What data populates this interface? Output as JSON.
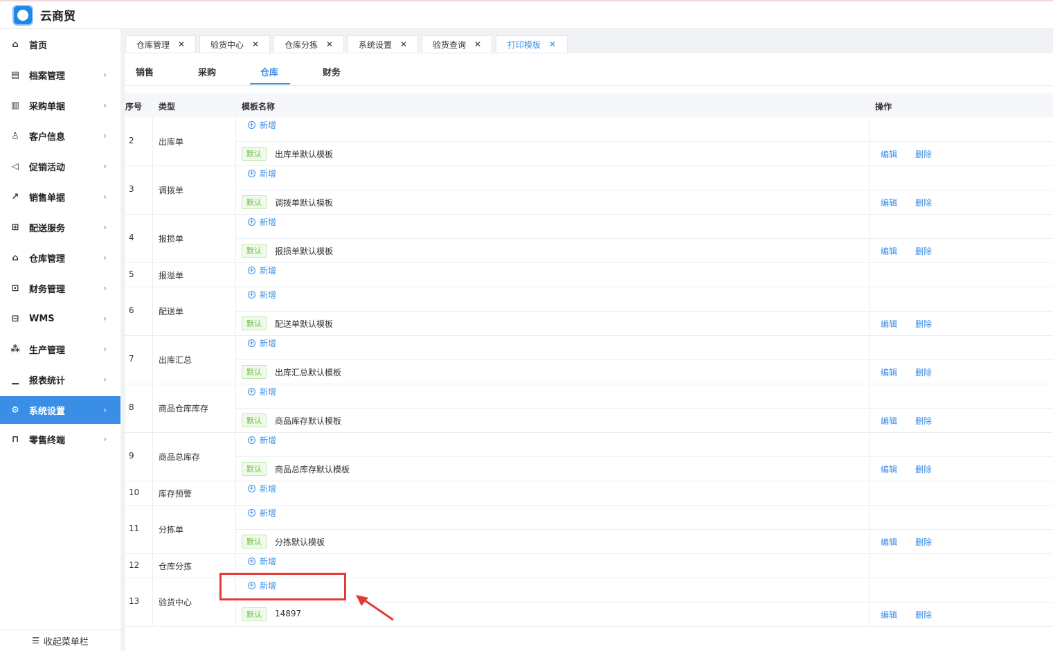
{
  "app": {
    "title": "云商贸"
  },
  "sidebar": {
    "items": [
      {
        "label": "首页",
        "icon": "home-icon",
        "glyph": "⌂",
        "chevron": false
      },
      {
        "label": "档案管理",
        "icon": "archive-icon",
        "glyph": "▤",
        "chevron": true
      },
      {
        "label": "采购单据",
        "icon": "document-icon",
        "glyph": "▥",
        "chevron": true
      },
      {
        "label": "客户信息",
        "icon": "user-icon",
        "glyph": "♙",
        "chevron": true
      },
      {
        "label": "促销活动",
        "icon": "megaphone-icon",
        "glyph": "◁",
        "chevron": true
      },
      {
        "label": "销售单据",
        "icon": "trend-chart-icon",
        "glyph": "↗",
        "chevron": true
      },
      {
        "label": "配送服务",
        "icon": "cart-icon",
        "glyph": "⊞",
        "chevron": true
      },
      {
        "label": "仓库管理",
        "icon": "warehouse-icon",
        "glyph": "⌂",
        "chevron": true
      },
      {
        "label": "财务管理",
        "icon": "finance-icon",
        "glyph": "⊡",
        "chevron": true
      },
      {
        "label": "WMS",
        "icon": "truck-icon",
        "glyph": "⊟",
        "chevron": true
      },
      {
        "label": "生产管理",
        "icon": "network-icon",
        "glyph": "⁂",
        "chevron": true
      },
      {
        "label": "报表统计",
        "icon": "bar-chart-icon",
        "glyph": "▁",
        "chevron": true
      },
      {
        "label": "系统设置",
        "icon": "gear-icon",
        "glyph": "⚙",
        "chevron": true,
        "active": true
      },
      {
        "label": "零售终端",
        "icon": "shopping-bag-icon",
        "glyph": "⊓",
        "chevron": true
      }
    ],
    "collapse_label": "收起菜单栏"
  },
  "tabs": [
    {
      "label": "仓库管理",
      "active": false
    },
    {
      "label": "验货中心",
      "active": false
    },
    {
      "label": "仓库分拣",
      "active": false
    },
    {
      "label": "系统设置",
      "active": false
    },
    {
      "label": "验货查询",
      "active": false
    },
    {
      "label": "打印模板",
      "active": true
    }
  ],
  "subtabs": [
    {
      "label": "销售",
      "active": false
    },
    {
      "label": "采购",
      "active": false
    },
    {
      "label": "仓库",
      "active": true
    },
    {
      "label": "财务",
      "active": false
    }
  ],
  "table": {
    "headers": {
      "index": "序号",
      "type": "类型",
      "name": "模板名称",
      "ops": "操作"
    },
    "add_label": "新增",
    "default_tag": "默认",
    "edit_label": "编辑",
    "delete_label": "删除",
    "rows": [
      {
        "index": "2",
        "type": "出库单",
        "templates": [
          "出库单默认模板"
        ]
      },
      {
        "index": "3",
        "type": "调拨单",
        "templates": [
          "调拨单默认模板"
        ]
      },
      {
        "index": "4",
        "type": "报损单",
        "templates": [
          "报损单默认模板"
        ]
      },
      {
        "index": "5",
        "type": "报溢单",
        "templates": []
      },
      {
        "index": "6",
        "type": "配送单",
        "templates": [
          "配送单默认模板"
        ]
      },
      {
        "index": "7",
        "type": "出库汇总",
        "templates": [
          "出库汇总默认模板"
        ]
      },
      {
        "index": "8",
        "type": "商品仓库库存",
        "templates": [
          "商品库存默认模板"
        ]
      },
      {
        "index": "9",
        "type": "商品总库存",
        "templates": [
          "商品总库存默认模板"
        ]
      },
      {
        "index": "10",
        "type": "库存预警",
        "templates": []
      },
      {
        "index": "11",
        "type": "分拣单",
        "templates": [
          "分拣默认模板"
        ]
      },
      {
        "index": "12",
        "type": "仓库分拣",
        "templates": []
      },
      {
        "index": "13",
        "type": "验货中心",
        "templates": [
          "14897"
        ]
      }
    ]
  },
  "annotation": {
    "color": "#e53935"
  }
}
